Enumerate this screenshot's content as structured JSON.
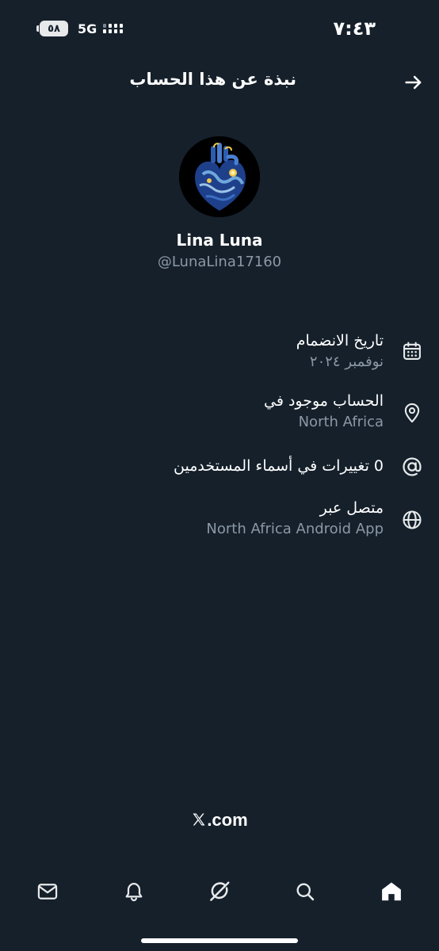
{
  "status_bar": {
    "time": "٧:٤٣",
    "battery": "٥٨",
    "network": "5G"
  },
  "header": {
    "title": "نبذة عن هذا الحساب"
  },
  "profile": {
    "display_name": "Lina Luna",
    "handle": "@LunaLina17160"
  },
  "info": [
    {
      "icon": "calendar-icon",
      "label": "تاريخ الانضمام",
      "value": "نوفمبر ٢٠٢٤"
    },
    {
      "icon": "location-pin-icon",
      "label": "الحساب موجود في",
      "value": "North Africa"
    },
    {
      "icon": "at-sign-icon",
      "label": "0 تغييرات في أسماء المستخدمين",
      "value": ""
    },
    {
      "icon": "globe-icon",
      "label": "متصل عبر",
      "value": "North Africa Android App"
    }
  ],
  "footer": {
    "brand_suffix": ".com"
  },
  "bottom_nav": [
    "mail-icon",
    "bell-icon",
    "grok-icon",
    "search-icon",
    "home-icon"
  ]
}
